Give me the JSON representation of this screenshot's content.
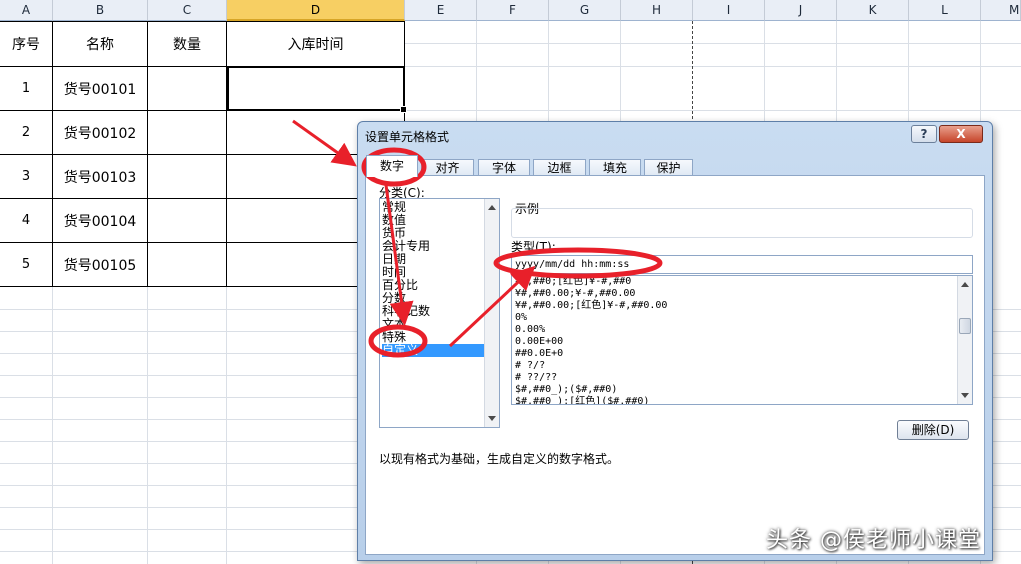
{
  "sheet": {
    "columns": [
      "A",
      "B",
      "C",
      "D",
      "E",
      "F",
      "G",
      "H",
      "I",
      "J",
      "K",
      "L",
      "M"
    ],
    "header_row": {
      "seq": "序号",
      "name": "名称",
      "qty": "数量",
      "time": "入库时间"
    },
    "rows": [
      {
        "seq": "1",
        "name": "货号00101"
      },
      {
        "seq": "2",
        "name": "货号00102"
      },
      {
        "seq": "3",
        "name": "货号00103"
      },
      {
        "seq": "4",
        "name": "货号00104"
      },
      {
        "seq": "5",
        "name": "货号00105"
      }
    ],
    "colors": {
      "header_bg": "#e9eef6",
      "selected_header": "#f7cf63",
      "gridline": "#dadfe6"
    }
  },
  "dialog": {
    "title": "设置单元格格式",
    "help_label": "?",
    "close_label": "X",
    "tabs": [
      "数字",
      "对齐",
      "字体",
      "边框",
      "填充",
      "保护"
    ],
    "active_tab": "数字",
    "category_label": "分类(C):",
    "categories": [
      "常规",
      "数值",
      "货币",
      "会计专用",
      "日期",
      "时间",
      "百分比",
      "分数",
      "科学记数",
      "文本",
      "特殊",
      "自定义"
    ],
    "selected_category": "自定义",
    "sample_label": "示例",
    "type_label": "类型(T):",
    "type_value": "yyyy/mm/dd hh:mm:ss",
    "formats": [
      "¥#,##0;[红色]¥-#,##0",
      "¥#,##0.00;¥-#,##0.00",
      "¥#,##0.00;[红色]¥-#,##0.00",
      "0%",
      "0.00%",
      "0.00E+00",
      "##0.0E+0",
      "# ?/?",
      "# ??/??",
      "$#,##0_);($#,##0)",
      "$#,##0_);[红色]($#,##0)"
    ],
    "delete_label": "删除(D)",
    "description": "以现有格式为基础，生成自定义的数字格式。",
    "colors": {
      "selection": "#3399ff",
      "annotation": "#e8202a",
      "close_button": "#c6452a"
    }
  },
  "watermark": "头条 @侯老师小课堂"
}
